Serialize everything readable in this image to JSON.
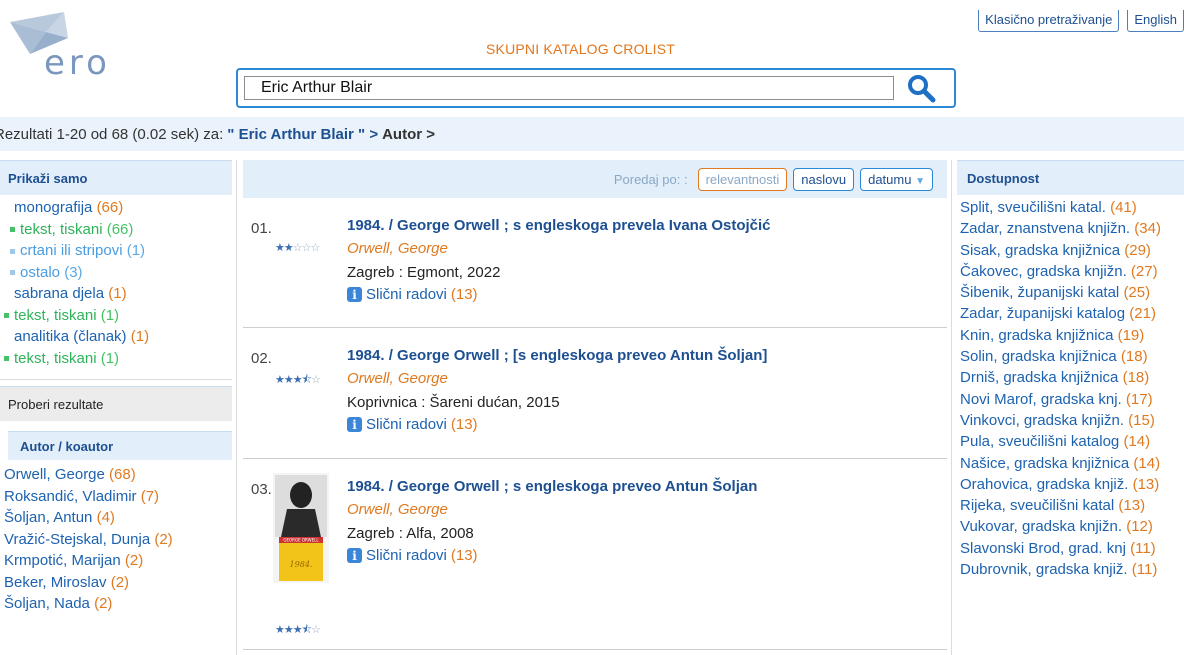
{
  "header": {
    "logo_text": "ero",
    "site_title": "SKUPNI KATALOG CROLIST",
    "links": [
      "Klasično pretraživanje",
      "English"
    ]
  },
  "search": {
    "value": "Eric Arthur Blair"
  },
  "results_bar": {
    "summary": "Rezultati 1-20 od 68 (0.02 sek) za:",
    "query": "\" Eric Arthur Blair \" >",
    "tail": "Autor >"
  },
  "left": {
    "show_only_title": "Prikaži samo",
    "filters": [
      {
        "label": "monografija",
        "count": "(66)",
        "style": "blue",
        "indent": 10
      },
      {
        "label": "tekst, tiskani",
        "count": "(66)",
        "style": "green",
        "indent": 6,
        "bullet": "#45c266"
      },
      {
        "label": "crtani ili stripovi",
        "count": "(1)",
        "style": "lb",
        "indent": 6,
        "bullet": "#9cc8ec"
      },
      {
        "label": "ostalo",
        "count": "(3)",
        "style": "lb",
        "indent": 6,
        "bullet": "#9cc8ec"
      },
      {
        "label": "sabrana djela",
        "count": "(1)",
        "style": "blue",
        "indent": 10
      },
      {
        "label": "tekst, tiskani",
        "count": "(1)",
        "style": "green",
        "indent": 0,
        "bullet": "#45c266"
      },
      {
        "label": "analitika (članak)",
        "count": "(1)",
        "style": "blue",
        "indent": 10
      },
      {
        "label": "tekst, tiskani",
        "count": "(1)",
        "style": "green",
        "indent": 0,
        "bullet": "#45c266"
      }
    ],
    "refine_title": "Proberi rezultate",
    "author_head": "Autor / koautor",
    "authors": [
      {
        "label": "Orwell, George",
        "count": "(68)"
      },
      {
        "label": "Roksandić, Vladimir",
        "count": "(7)"
      },
      {
        "label": "Šoljan, Antun",
        "count": "(4)"
      },
      {
        "label": "Vražić-Stejskal, Dunja",
        "count": "(2)"
      },
      {
        "label": "Krmpotić, Marijan",
        "count": "(2)"
      },
      {
        "label": "Beker, Miroslav",
        "count": "(2)"
      },
      {
        "label": "Šoljan, Nada",
        "count": "(2)"
      }
    ]
  },
  "sort": {
    "label": "Poredaj po: :",
    "options": [
      "relevantnosti",
      "naslovu",
      "datumu"
    ],
    "active": "relevantnosti"
  },
  "records": [
    {
      "num": "01.",
      "stars": 2,
      "title": "1984. / George Orwell ; s engleskoga prevela Ivana Ostojčić",
      "author": "Orwell, George",
      "publisher": "Zagreb : Egmont, 2022",
      "similar": "Slični radovi",
      "similar_count": "(13)"
    },
    {
      "num": "02.",
      "stars": 3.5,
      "title": "1984. / George Orwell ; [s engleskoga preveo Antun Šoljan]",
      "author": "Orwell, George",
      "publisher": "Koprivnica : Šareni dućan, 2015",
      "similar": "Slični radovi",
      "similar_count": "(13)"
    },
    {
      "num": "03.",
      "stars": 3.5,
      "title": "1984. / George Orwell ; s engleskoga preveo Antun Šoljan",
      "author": "Orwell, George",
      "publisher": "Zagreb : Alfa, 2008",
      "similar": "Slični radovi",
      "similar_count": "(13)",
      "cover": {
        "author": "GEORGE ORWELL",
        "title": "1984."
      }
    }
  ],
  "right": {
    "title": "Dostupnost",
    "items": [
      {
        "label": "Split, sveučilišni katal.",
        "count": "(41)"
      },
      {
        "label": "Zadar, znanstvena knjižn.",
        "count": "(34)"
      },
      {
        "label": "Sisak, gradska knjižnica",
        "count": "(29)"
      },
      {
        "label": "Čakovec, gradska knjižn.",
        "count": "(27)"
      },
      {
        "label": "Šibenik, županijski katal",
        "count": "(25)"
      },
      {
        "label": "Zadar, županijski katalog",
        "count": "(21)"
      },
      {
        "label": "Knin, gradska knjižnica",
        "count": "(19)"
      },
      {
        "label": "Solin, gradska knjižnica",
        "count": "(18)"
      },
      {
        "label": "Drniš, gradska knjižnica",
        "count": "(18)"
      },
      {
        "label": "Novi Marof, gradska knj.",
        "count": "(17)"
      },
      {
        "label": "Vinkovci, gradska knjižn.",
        "count": "(15)"
      },
      {
        "label": "Pula, sveučilišni katalog",
        "count": "(14)"
      },
      {
        "label": "Našice, gradska knjižnica",
        "count": "(14)"
      },
      {
        "label": "Orahovica, gradska knjiž.",
        "count": "(13)"
      },
      {
        "label": "Rijeka, sveučilišni katal",
        "count": "(13)"
      },
      {
        "label": "Vukovar, gradska knjižn.",
        "count": "(12)"
      },
      {
        "label": "Slavonski Brod, grad. knj",
        "count": "(11)"
      },
      {
        "label": "Dubrovnik, gradska knjiž.",
        "count": "(11)"
      }
    ]
  },
  "icons": {
    "logo": "ero-logo-icon",
    "search": "magnifier-icon",
    "info": "info-icon",
    "stars": "star-rating-icon"
  }
}
